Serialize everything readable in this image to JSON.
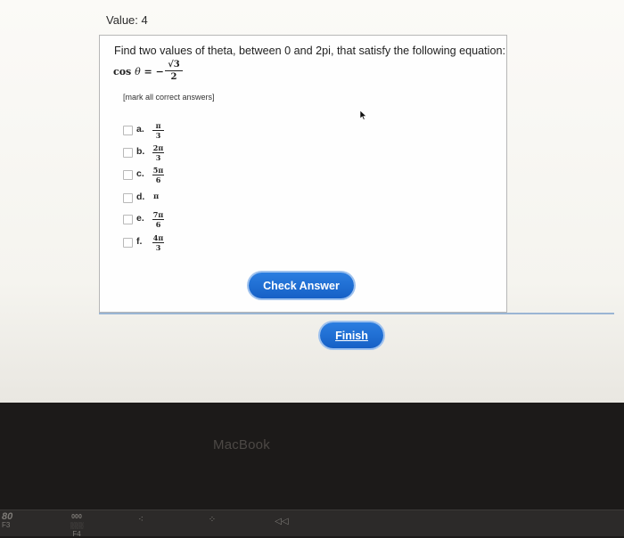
{
  "page": {
    "value_label": "Value: 4",
    "question": "Find two values of theta, between 0 and 2pi, that satisfy the following equation:",
    "equation": {
      "lhs": "cos",
      "variable": "θ",
      "relation": " = −",
      "numerator": "√3",
      "denominator": "2"
    },
    "hint": "[mark all correct answers]"
  },
  "options": [
    {
      "letter": "a.",
      "numerator": "π",
      "denominator": "3"
    },
    {
      "letter": "b.",
      "numerator": "2π",
      "denominator": "3"
    },
    {
      "letter": "c.",
      "numerator": "5π",
      "denominator": "6"
    },
    {
      "letter": "d.",
      "value": "π"
    },
    {
      "letter": "e.",
      "numerator": "7π",
      "denominator": "6"
    },
    {
      "letter": "f.",
      "numerator": "4π",
      "denominator": "3"
    }
  ],
  "buttons": {
    "check_answer": "Check Answer",
    "finish": "Finish"
  },
  "laptop": {
    "brand": "MacBook"
  },
  "keyboard": {
    "f3_icon": "80",
    "f3_label": "F3",
    "f4_icon": "000",
    "f4_label": "F4"
  },
  "colors": {
    "button_blue": "#1f6fd6",
    "button_ring": "#9fc2ee",
    "divider": "#9ab5d4"
  }
}
